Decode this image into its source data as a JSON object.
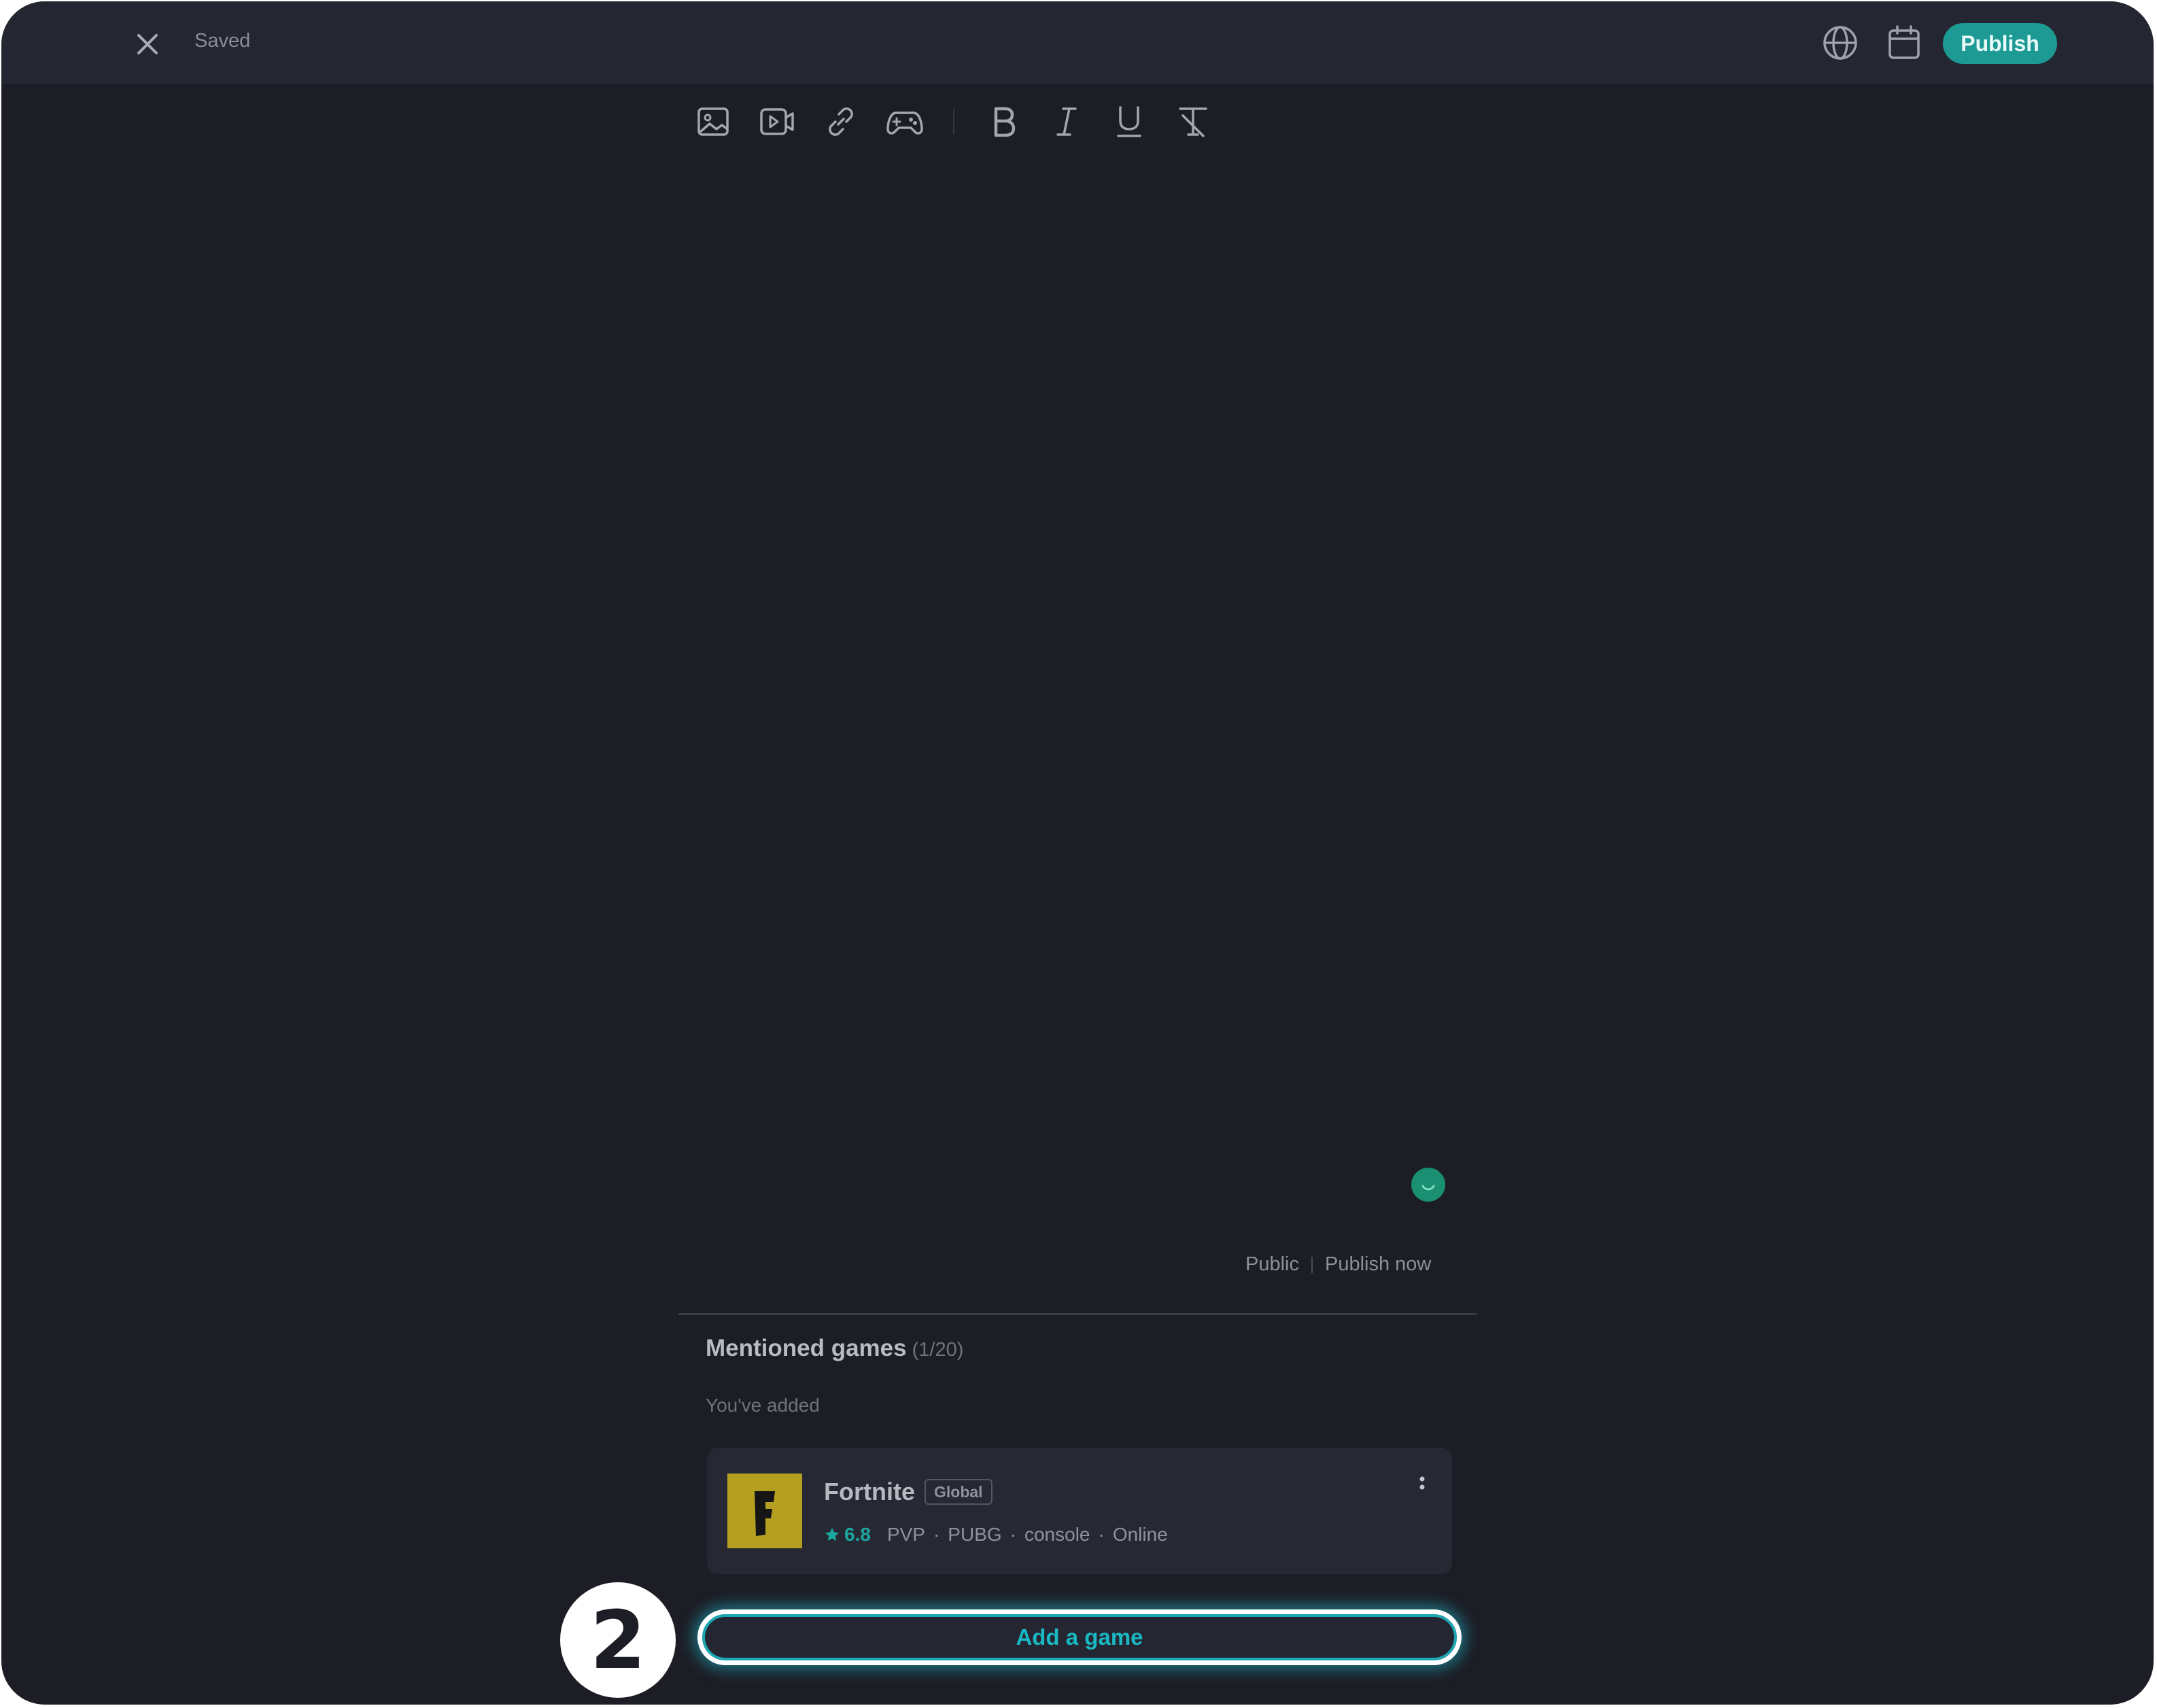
{
  "header": {
    "status": "Saved",
    "publish_label": "Publish",
    "icons": [
      "close-icon",
      "globe-icon",
      "calendar-icon"
    ]
  },
  "toolbar": {
    "icons": [
      "image-icon",
      "video-icon",
      "link-icon",
      "gamepad-icon",
      "bold-icon",
      "italic-icon",
      "underline-icon",
      "clear-format-icon"
    ]
  },
  "footer": {
    "visibility": "Public",
    "schedule": "Publish now"
  },
  "mentioned": {
    "title": "Mentioned games",
    "count": "(1/20)",
    "subtitle": "You've added",
    "games": [
      {
        "name": "Fortnite",
        "badge": "Global",
        "logo_letter": "F",
        "rating": "6.8",
        "tags": [
          "PVP",
          "PUBG",
          "console",
          "Online"
        ]
      }
    ]
  },
  "add_game_label": "Add a game",
  "step_number": "2",
  "colors": {
    "accent": "#1e9a95",
    "highlight": "#1ab8c3",
    "background": "#1c1d25",
    "topbar": "#242731",
    "logo": "#b59f21"
  }
}
